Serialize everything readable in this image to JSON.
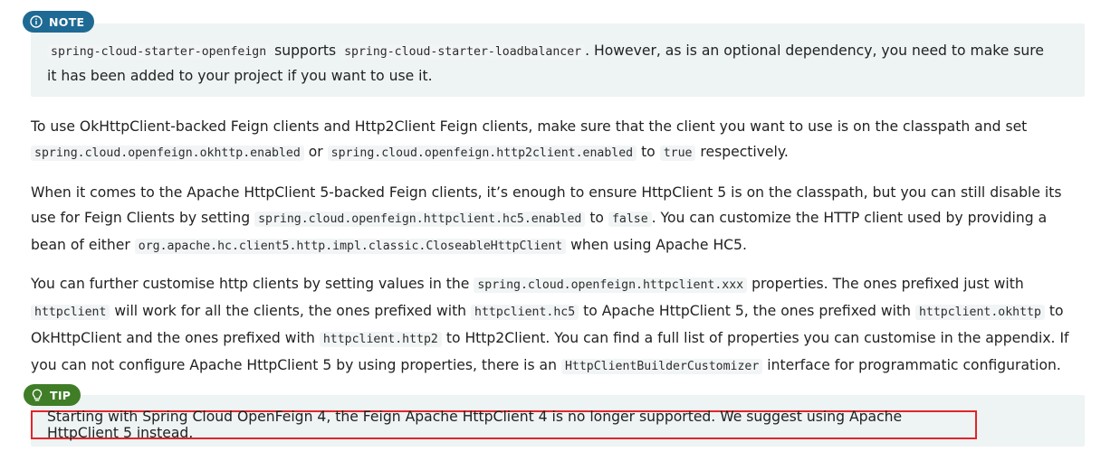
{
  "note": {
    "label": "NOTE",
    "code1": "spring-cloud-starter-openfeign",
    "t1": " supports ",
    "code2": "spring-cloud-starter-loadbalancer",
    "t2": ". However, as is an optional dependency, you need to make sure it has been added to your project if you want to use it."
  },
  "p1": {
    "t1": "To use OkHttpClient-backed Feign clients and Http2Client Feign clients, make sure that the client you want to use is on the classpath and set ",
    "c1": "spring.cloud.openfeign.okhttp.enabled",
    "t2": " or ",
    "c2": "spring.cloud.openfeign.http2client.enabled",
    "t3": " to ",
    "c3": "true",
    "t4": " respectively."
  },
  "p2": {
    "t1": "When it comes to the Apache HttpClient 5-backed Feign clients, it’s enough to ensure HttpClient 5 is on the classpath, but you can still disable its use for Feign Clients by setting ",
    "c1": "spring.cloud.openfeign.httpclient.hc5.enabled",
    "t2": " to ",
    "c2": "false",
    "t3": ". You can customize the HTTP client used by providing a bean of either ",
    "c3": "org.apache.hc.client5.http.impl.classic.CloseableHttpClient",
    "t4": " when using Apache HC5."
  },
  "p3": {
    "t1": "You can further customise http clients by setting values in the ",
    "c1": "spring.cloud.openfeign.httpclient.xxx",
    "t2": " properties. The ones prefixed just with ",
    "c2": "httpclient",
    "t3": " will work for all the clients, the ones prefixed with ",
    "c3": "httpclient.hc5",
    "t4": " to Apache HttpClient 5, the ones prefixed with ",
    "c4": "httpclient.okhttp",
    "t5": " to OkHttpClient and the ones prefixed with ",
    "c5": "httpclient.http2",
    "t6": " to Http2Client. You can find a full list of properties you can customise in the appendix. If you can not configure Apache HttpClient 5 by using properties, there is an ",
    "c6": "HttpClientBuilderCustomizer",
    "t7": " interface for programmatic configuration."
  },
  "tip": {
    "label": "TIP",
    "text": "Starting with Spring Cloud OpenFeign 4, the Feign Apache HttpClient 4 is no longer supported. We suggest using Apache HttpClient 5 instead."
  },
  "colors": {
    "note_badge": "#1e6a94",
    "tip_badge": "#3f7d27",
    "admonition_bg": "#eef3f3",
    "highlight_border": "#e1252a"
  },
  "icons": {
    "note": "info-circle-icon",
    "tip": "lightbulb-icon"
  }
}
